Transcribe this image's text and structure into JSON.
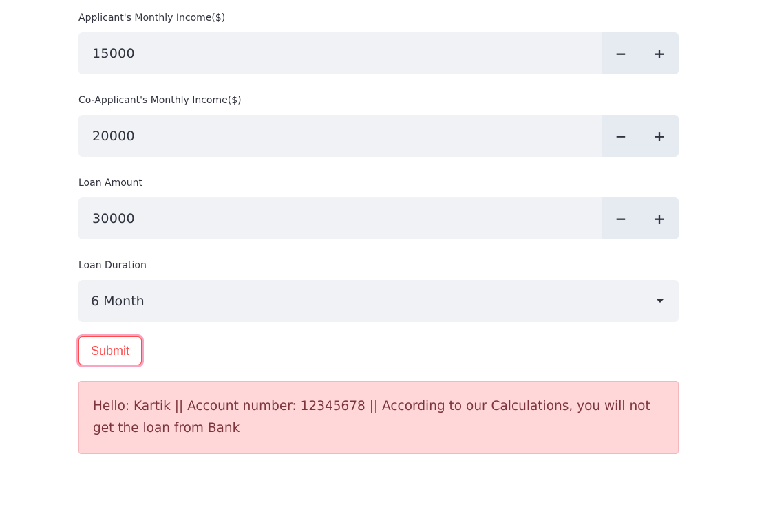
{
  "form": {
    "fields": [
      {
        "label": "Applicant's Monthly Income($)",
        "value": "15000"
      },
      {
        "label": "Co-Applicant's Monthly Income($)",
        "value": "20000"
      },
      {
        "label": "Loan Amount",
        "value": "30000"
      }
    ],
    "stepper": {
      "minus": "−",
      "plus": "+"
    },
    "duration": {
      "label": "Loan Duration",
      "value": "6 Month"
    },
    "submit_label": "Submit"
  },
  "result": {
    "message": "Hello: Kartik || Account number: 12345678 || According to our Calculations, you will not get the loan from Bank"
  },
  "colors": {
    "accent": "#ff4b4b",
    "input_bg": "#f0f2f6",
    "error_bg": "#ffd7d9",
    "error_text": "#7d353b"
  },
  "icons": {
    "stepper_minus": "minus-icon",
    "stepper_plus": "plus-icon",
    "select_caret": "chevron-down-icon"
  }
}
